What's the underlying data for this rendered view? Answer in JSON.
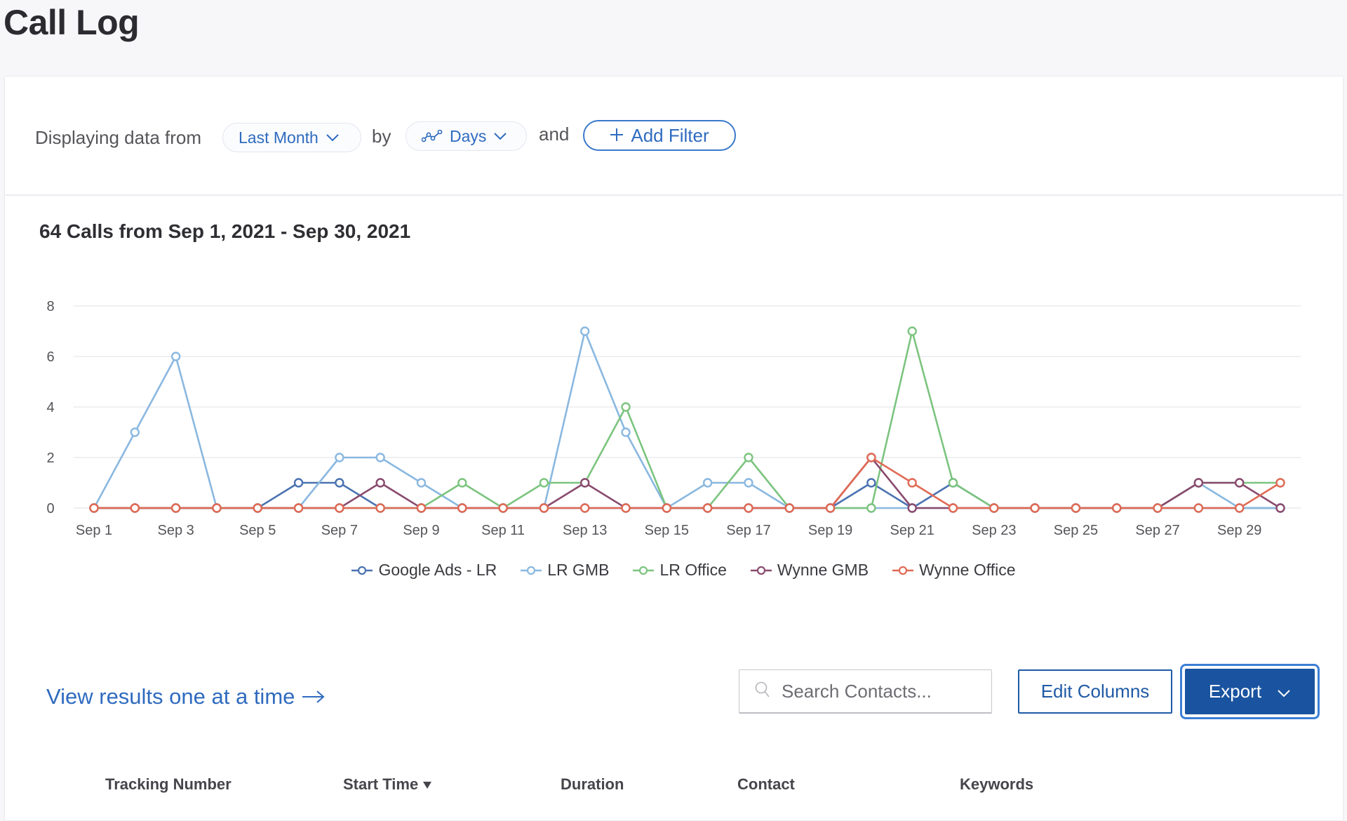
{
  "page": {
    "title": "Call Log"
  },
  "filters": {
    "prefix": "Displaying data from",
    "range_value": "Last Month",
    "by_label": "by",
    "interval_value": "Days",
    "and_label": "and",
    "add_filter_label": "Add Filter"
  },
  "icons": {
    "range_chevron": "chevron-down-icon",
    "interval_icon": "line-chart-icon",
    "add": "plus-icon",
    "search": "search-icon",
    "arrow": "arrow-right-icon",
    "sort": "sort-desc-icon"
  },
  "colors": {
    "accent": "#2f6bbf",
    "primary_button": "#1a54a0",
    "focus_ring": "#3b7fd6"
  },
  "chart_data": {
    "type": "line",
    "title": "64 Calls from Sep 1, 2021 - Sep 30, 2021",
    "xlabel": "",
    "ylabel": "",
    "ylim": [
      0,
      8
    ],
    "yticks": [
      0,
      2,
      4,
      6,
      8
    ],
    "grid": true,
    "legend_position": "bottom-center",
    "x": [
      "Sep 1",
      "Sep 2",
      "Sep 3",
      "Sep 4",
      "Sep 5",
      "Sep 6",
      "Sep 7",
      "Sep 8",
      "Sep 9",
      "Sep 10",
      "Sep 11",
      "Sep 12",
      "Sep 13",
      "Sep 14",
      "Sep 15",
      "Sep 16",
      "Sep 17",
      "Sep 18",
      "Sep 19",
      "Sep 20",
      "Sep 21",
      "Sep 22",
      "Sep 23",
      "Sep 24",
      "Sep 25",
      "Sep 26",
      "Sep 27",
      "Sep 28",
      "Sep 29",
      "Sep 30"
    ],
    "xtick_labels": [
      "Sep 1",
      "Sep 3",
      "Sep 5",
      "Sep 7",
      "Sep 9",
      "Sep 11",
      "Sep 13",
      "Sep 15",
      "Sep 17",
      "Sep 19",
      "Sep 21",
      "Sep 23",
      "Sep 25",
      "Sep 27",
      "Sep 29"
    ],
    "series": [
      {
        "name": "Google Ads - LR",
        "color": "#4a72b0",
        "values": [
          0,
          0,
          0,
          0,
          0,
          1,
          1,
          0,
          0,
          0,
          0,
          0,
          0,
          0,
          0,
          0,
          0,
          0,
          0,
          1,
          0,
          1,
          0,
          0,
          0,
          0,
          0,
          0,
          0,
          0
        ]
      },
      {
        "name": "LR GMB",
        "color": "#8ab8e0",
        "values": [
          0,
          3,
          6,
          0,
          0,
          0,
          2,
          2,
          1,
          0,
          0,
          0,
          7,
          3,
          0,
          1,
          1,
          0,
          0,
          0,
          0,
          0,
          0,
          0,
          0,
          0,
          0,
          1,
          0,
          0
        ]
      },
      {
        "name": "LR Office",
        "color": "#7cc47f",
        "values": [
          0,
          0,
          0,
          0,
          0,
          0,
          0,
          0,
          0,
          1,
          0,
          1,
          1,
          4,
          0,
          0,
          2,
          0,
          0,
          0,
          7,
          1,
          0,
          0,
          0,
          0,
          0,
          1,
          1,
          1
        ]
      },
      {
        "name": "Wynne GMB",
        "color": "#8a4a6e",
        "values": [
          0,
          0,
          0,
          0,
          0,
          0,
          0,
          1,
          0,
          0,
          0,
          0,
          1,
          0,
          0,
          0,
          0,
          0,
          0,
          2,
          0,
          0,
          0,
          0,
          0,
          0,
          0,
          1,
          1,
          0
        ]
      },
      {
        "name": "Wynne Office",
        "color": "#e06a55",
        "values": [
          0,
          0,
          0,
          0,
          0,
          0,
          0,
          0,
          0,
          0,
          0,
          0,
          0,
          0,
          0,
          0,
          0,
          0,
          0,
          2,
          1,
          0,
          0,
          0,
          0,
          0,
          0,
          0,
          0,
          1
        ]
      }
    ]
  },
  "results": {
    "view_link_label": "View results one at a time",
    "search_placeholder": "Search Contacts...",
    "search_value": "",
    "edit_columns_label": "Edit Columns",
    "export_label": "Export"
  },
  "table": {
    "columns": [
      {
        "label": "Tracking Number",
        "sorted": false
      },
      {
        "label": "Start Time",
        "sorted": true,
        "direction": "desc"
      },
      {
        "label": "Duration",
        "sorted": false
      },
      {
        "label": "Contact",
        "sorted": false
      },
      {
        "label": "Keywords",
        "sorted": false
      }
    ]
  }
}
